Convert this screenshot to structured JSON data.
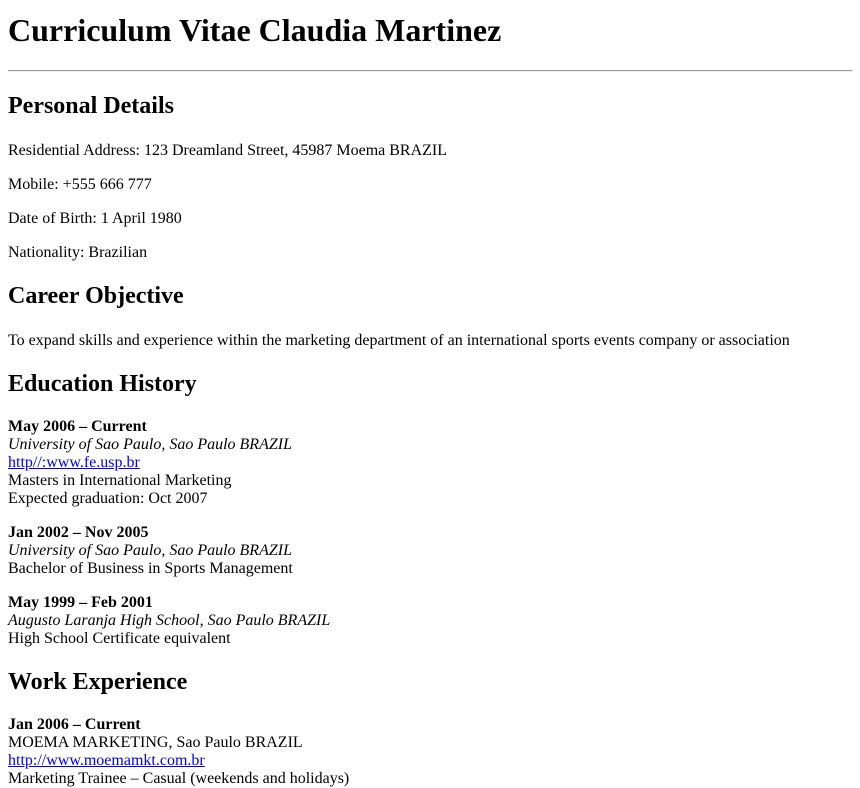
{
  "title": "Curriculum Vitae Claudia Martinez",
  "personal": {
    "heading": "Personal Details",
    "address": "Residential Address: 123 Dreamland Street, 45987 Moema BRAZIL",
    "mobile": "Mobile: +555 666 777",
    "dob": "Date of Birth: 1 April 1980",
    "nationality": "Nationality: Brazilian"
  },
  "objective": {
    "heading": "Career Objective",
    "text": "To expand skills and experience within the marketing department of an international sports events company or association"
  },
  "education": {
    "heading": "Education History",
    "entries": [
      {
        "dates": "May 2006 – Current",
        "institution": "University of Sao Paulo, Sao Paulo BRAZIL",
        "link": "http//:www.fe.usp.br",
        "degree": "Masters in International Marketing",
        "note": "Expected graduation: Oct 2007"
      },
      {
        "dates": "Jan 2002 – Nov 2005",
        "institution": "University of Sao Paulo, Sao Paulo BRAZIL",
        "degree": "Bachelor of Business in Sports Management"
      },
      {
        "dates": "May 1999 – Feb 2001",
        "institution": "Augusto Laranja High School, Sao Paulo BRAZIL",
        "degree": "High School Certificate equivalent"
      }
    ]
  },
  "work": {
    "heading": "Work Experience",
    "entries": [
      {
        "dates": "Jan 2006 – Current",
        "employer": "MOEMA MARKETING, Sao Paulo BRAZIL",
        "link": "http://www.moemamkt.com.br",
        "role": "Marketing Trainee – Casual (weekends and holidays)"
      }
    ]
  }
}
